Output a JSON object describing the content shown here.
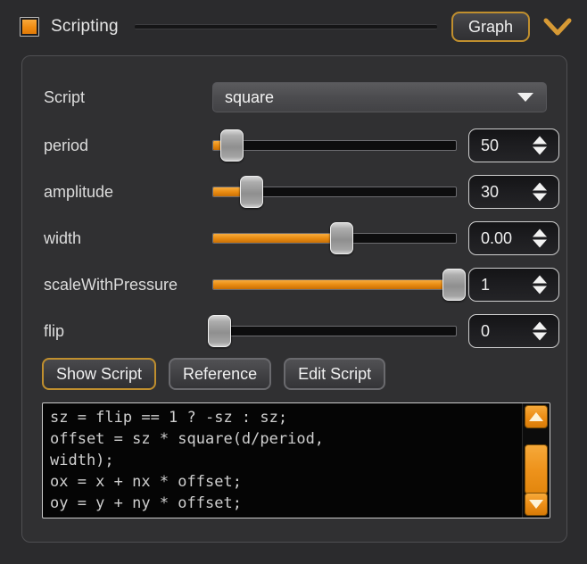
{
  "header": {
    "checkbox_checked": true,
    "title": "Scripting",
    "graph_button": "Graph",
    "collapse_icon": "chevron-down-icon",
    "accent_color": "#ef8b12",
    "border_accent": "#c08f2e"
  },
  "panel": {
    "script_row": {
      "label": "Script",
      "selected": "square",
      "dropdown_icon": "triangle-down-icon"
    },
    "sliders": [
      {
        "label": "period",
        "value": "50",
        "fill_percent": 4,
        "handle_percent": 8
      },
      {
        "label": "amplitude",
        "value": "30",
        "fill_percent": 12,
        "handle_percent": 16
      },
      {
        "label": "width",
        "value": "0.00",
        "fill_percent": 51,
        "handle_percent": 53
      },
      {
        "label": "scaleWithPressure",
        "value": "1",
        "fill_percent": 100,
        "handle_percent": 99
      },
      {
        "label": "flip",
        "value": "0",
        "fill_percent": 0,
        "handle_percent": 3
      }
    ],
    "buttons": [
      {
        "label": "Show Script",
        "active": true
      },
      {
        "label": "Reference",
        "active": false
      },
      {
        "label": "Edit Script",
        "active": false
      }
    ],
    "code": "sz = flip == 1 ? -sz : sz;\noffset = sz * square(d/period,\nwidth);\nox = x + nx * offset;\noy = y + ny * offset;",
    "scrollbar": {
      "up_icon": "triangle-up-icon",
      "down_icon": "triangle-down-icon",
      "thumb_color": "#ee931c"
    }
  }
}
